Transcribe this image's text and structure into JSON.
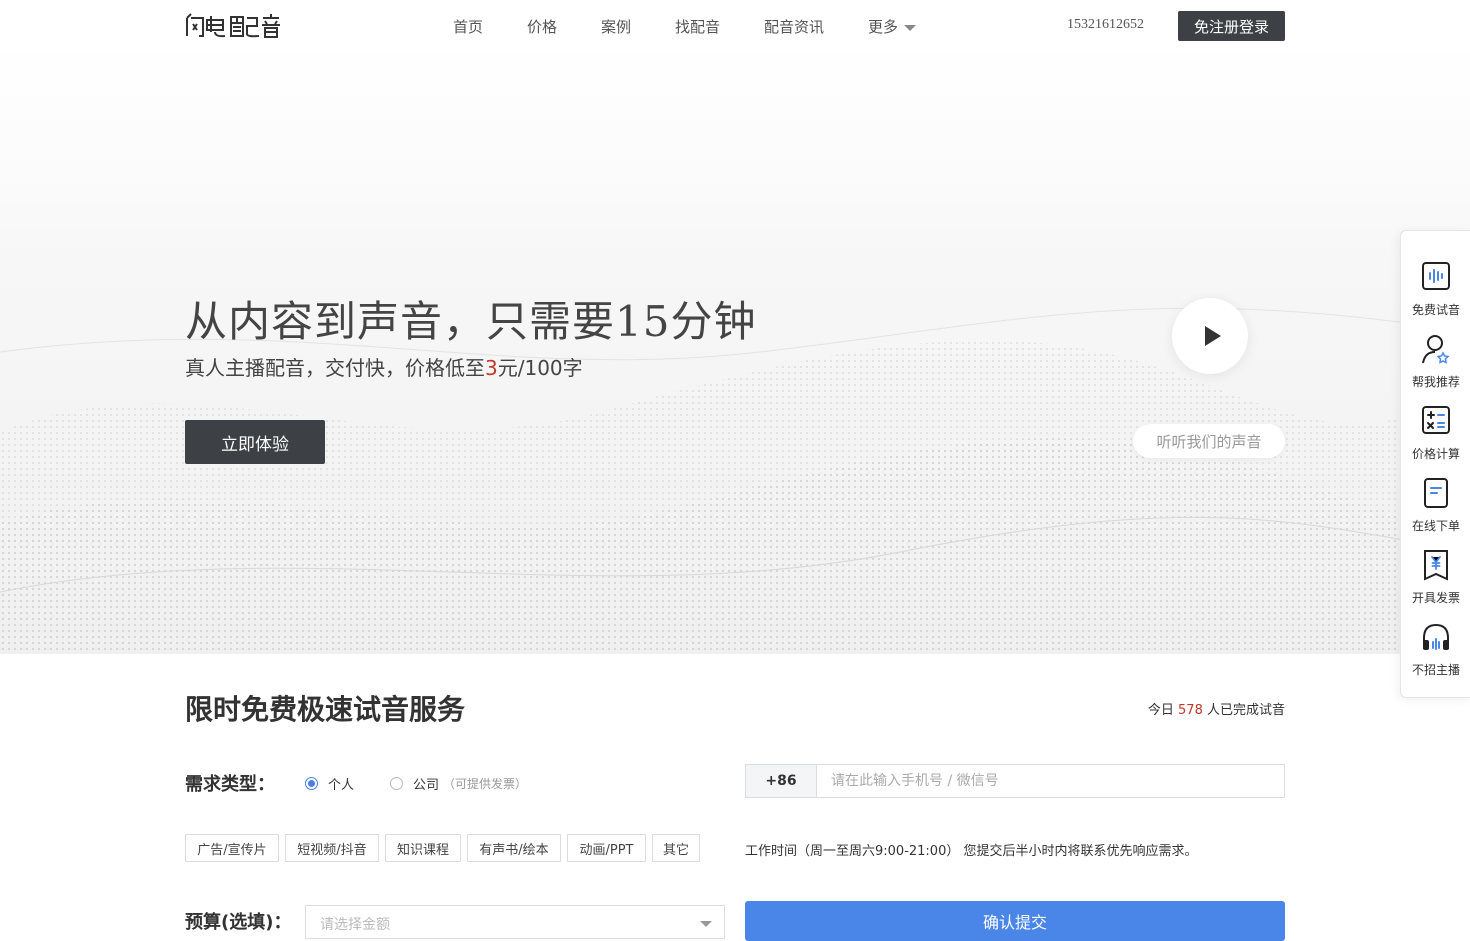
{
  "header": {
    "logo_text": "闪电配音",
    "nav": [
      "首页",
      "价格",
      "案例",
      "找配音",
      "配音资讯",
      "更多"
    ],
    "phone": "15321612652",
    "login_label": "免注册登录"
  },
  "hero": {
    "title": "从内容到声音，只需要15分钟",
    "subtitle_pre": "真人主播配音，交付快，价格低至",
    "subtitle_price": "3",
    "subtitle_post": "元/100字",
    "cta_label": "立即体验",
    "listen_label": "听听我们的声音"
  },
  "sidebar": [
    {
      "label": "免费试音",
      "icon": "voice-wave-icon"
    },
    {
      "label": "帮我推荐",
      "icon": "user-star-icon"
    },
    {
      "label": "价格计算",
      "icon": "calculator-icon"
    },
    {
      "label": "在线下单",
      "icon": "document-icon"
    },
    {
      "label": "开具发票",
      "icon": "invoice-icon"
    },
    {
      "label": "不招主播",
      "icon": "headphones-icon"
    }
  ],
  "trial": {
    "title": "限时免费极速试音服务",
    "today_pre": "今日 ",
    "today_count": "578",
    "today_post": " 人已完成试音",
    "req_label": "需求类型：",
    "options": [
      {
        "label": "个人",
        "selected": true
      },
      {
        "label": "公司",
        "hint": "（可提供发票）",
        "selected": false
      }
    ],
    "country_code": "+86",
    "phone_placeholder": "请在此输入手机号 / 微信号",
    "tags": [
      "广告/宣传片",
      "短视频/抖音",
      "知识课程",
      "有声书/绘本",
      "动画/PPT",
      "其它"
    ],
    "work_note": "工作时间（周一至周六9:00-21:00） 您提交后半小时内将联系优先响应需求。",
    "budget_label": "预算(选填)：",
    "budget_placeholder": "请选择金额",
    "submit_label": "确认提交"
  },
  "colors": {
    "dark_button": "#3d4045",
    "accent_red": "#c0392b",
    "accent_blue": "#4a86e8"
  }
}
